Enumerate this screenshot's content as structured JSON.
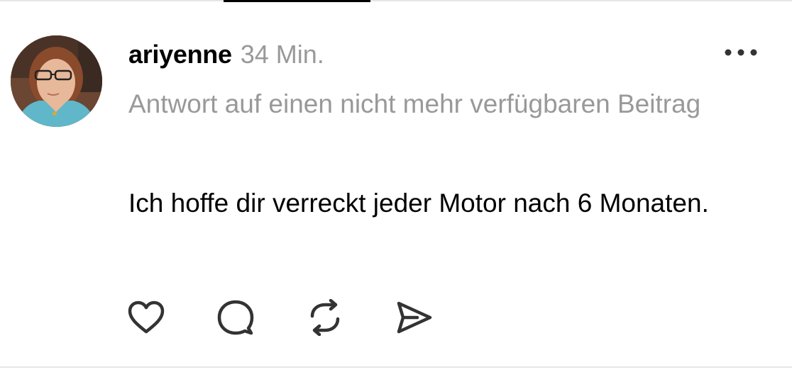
{
  "post": {
    "username": "ariyenne",
    "timestamp": "34 Min.",
    "reply_context": "Antwort auf einen nicht mehr verfügbaren Beitrag",
    "body": "Ich hoffe dir verreckt jeder Motor nach 6 Monaten."
  },
  "icons": {
    "more": "more-horizontal-icon",
    "like": "heart-icon",
    "reply": "comment-bubble-icon",
    "repost": "repost-icon",
    "share": "send-icon"
  },
  "colors": {
    "text_primary": "#000000",
    "text_secondary": "#999999",
    "icon": "#333333",
    "divider": "#e6e6e6"
  }
}
